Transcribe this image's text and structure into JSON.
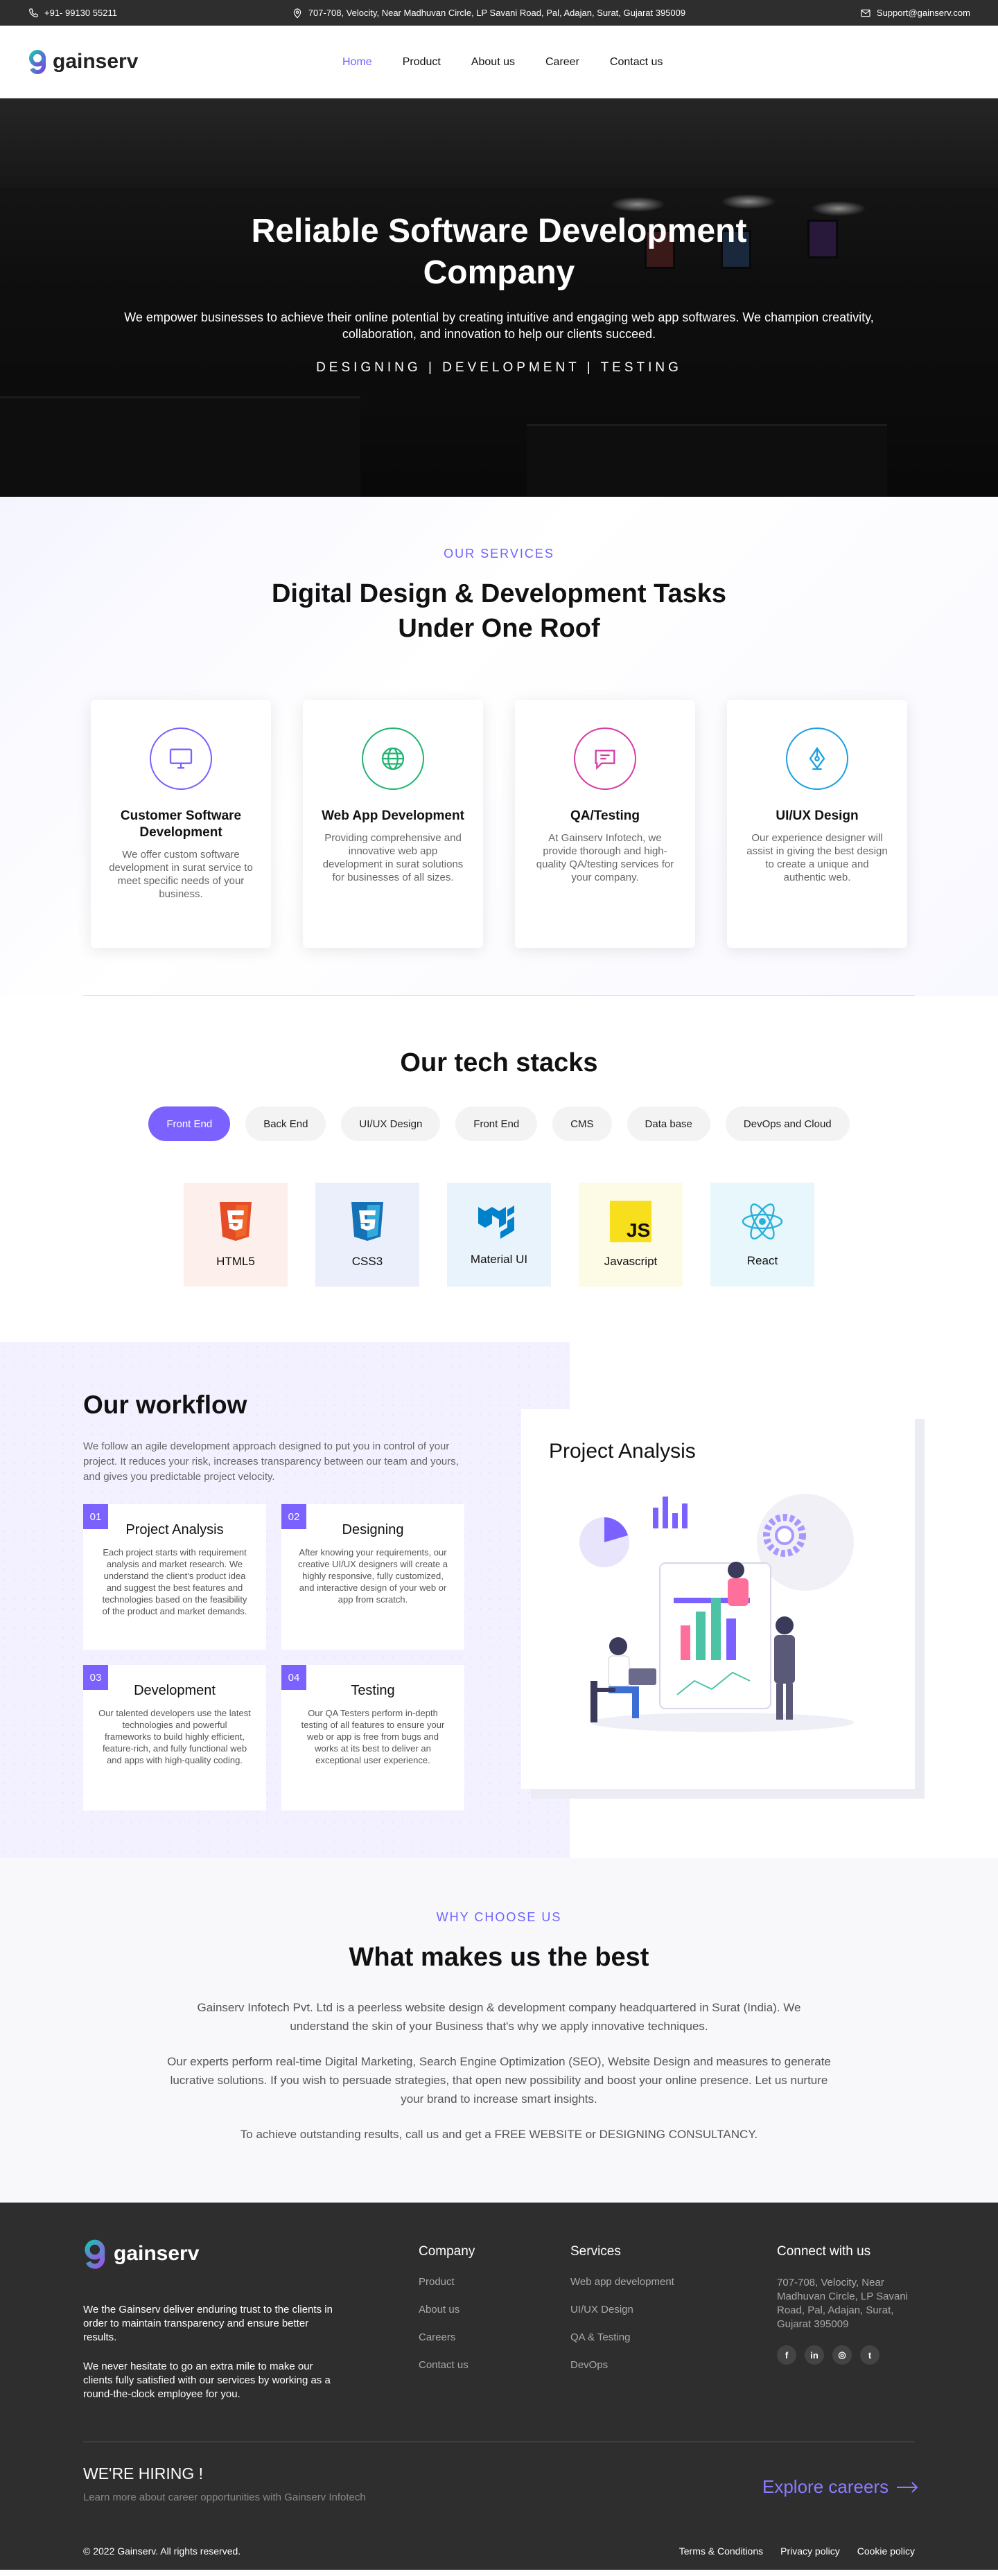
{
  "topbar": {
    "phone": "+91- 99130 55211",
    "address": "707-708, Velocity, Near Madhuvan Circle, LP Savani Road, Pal, Adajan, Surat, Gujarat 395009",
    "email": "Support@gainserv.com"
  },
  "brand": {
    "name": "gainserv",
    "accent": "#6c63ff"
  },
  "nav": [
    "Home",
    "Product",
    "About us",
    "Career",
    "Contact us"
  ],
  "hero": {
    "title": "Reliable Software Development Company",
    "subtitle": "We empower businesses to achieve their online potential by creating intuitive and engaging web app softwares. We champion creativity, collaboration, and innovation to help our clients succeed.",
    "tagline": "DESIGNING | DEVELOPMENT | TESTING"
  },
  "services": {
    "eyebrow": "OUR SERVICES",
    "title": "Digital Design & Development Tasks Under One Roof",
    "cards": [
      {
        "title": "Customer Software Development",
        "text": "We offer custom software development in surat service to meet specific needs of your business.",
        "icon": "monitor-icon",
        "color": "#7b61ff"
      },
      {
        "title": "Web App Development",
        "text": "Providing comprehensive and innovative web app development in surat solutions for businesses of all sizes.",
        "icon": "globe-icon",
        "color": "#21b573"
      },
      {
        "title": "QA/Testing",
        "text": "At Gainserv Infotech, we provide thorough and high-quality QA/testing services for your company.",
        "icon": "chat-icon",
        "color": "#d63ca6"
      },
      {
        "title": "UI/UX Design",
        "text": "Our experience designer will assist in giving the best design to create a unique and authentic web.",
        "icon": "pen-tool-icon",
        "color": "#1ea0e0"
      }
    ]
  },
  "tech": {
    "title": "Our tech stacks",
    "tabs": [
      "Front End",
      "Back End",
      "UI/UX Design",
      "Front End",
      "CMS",
      "Data base",
      "DevOps and Cloud"
    ],
    "items": [
      {
        "label": "HTML5",
        "bg": "#fdf0ec",
        "icon": "html5-icon"
      },
      {
        "label": "CSS3",
        "bg": "#ebeffc",
        "icon": "css3-icon"
      },
      {
        "label": "Material UI",
        "bg": "#e8f3fc",
        "icon": "material-ui-icon"
      },
      {
        "label": "Javascript",
        "bg": "#fdfbe6",
        "icon": "javascript-icon"
      },
      {
        "label": "React",
        "bg": "#e8f7fc",
        "icon": "react-icon"
      }
    ]
  },
  "workflow": {
    "title": "Our workflow",
    "intro": "We follow an agile development approach designed to put you in control of your project. It reduces your risk, increases transparency between our team and yours, and gives you predictable project velocity.",
    "steps": [
      {
        "num": "01",
        "title": "Project Analysis",
        "text": "Each project starts with requirement analysis and market research. We understand the client's product idea and suggest the best features and technologies based on the feasibility of the product and market demands."
      },
      {
        "num": "02",
        "title": "Designing",
        "text": "After knowing your requirements, our creative UI/UX designers will create a highly responsive, fully customized, and interactive design of your web or app from scratch."
      },
      {
        "num": "03",
        "title": "Development",
        "text": "Our talented developers use the latest technologies and powerful frameworks to build highly efficient, feature-rich, and fully functional web and apps with high-quality coding."
      },
      {
        "num": "04",
        "title": "Testing",
        "text": "Our QA Testers perform in-depth testing of all features to ensure your web or app is free from bugs and works at its best to deliver an exceptional user experience."
      }
    ],
    "panel_title": "Project Analysis"
  },
  "why": {
    "eyebrow": "WHY CHOOSE US",
    "title": "What makes us the best",
    "p1": "Gainserv Infotech Pvt. Ltd is a peerless website design & development company headquartered in Surat (India). We understand the skin of your Business that's why we apply innovative techniques.",
    "p2": "Our experts perform real-time Digital Marketing, Search Engine Optimization (SEO), Website Design and measures to generate lucrative solutions. If you wish to persuade strategies, that open new possibility and boost your online presence. Let us nurture your brand to increase smart insights.",
    "p3": "To achieve outstanding results, call us and get a FREE WEBSITE or DESIGNING CONSULTANCY."
  },
  "footer": {
    "about1": "We the Gainserv deliver enduring trust to the clients in order to maintain transparency and ensure better results.",
    "about2": "We never hesitate to go an extra mile to make our clients fully satisfied with our services by working as a round-the-clock employee for you.",
    "company": {
      "title": "Company",
      "links": [
        "Product",
        "About us",
        "Careers",
        "Contact us"
      ]
    },
    "services": {
      "title": "Services",
      "links": [
        "Web app development",
        "UI/UX Design",
        "QA & Testing",
        "DevOps"
      ]
    },
    "connect": {
      "title": "Connect with us",
      "address": "707-708, Velocity, Near Madhuvan Circle, LP Savani Road, Pal, Adajan, Surat, Gujarat 395009",
      "socials": [
        "facebook-icon",
        "linkedin-icon",
        "instagram-icon",
        "twitter-icon"
      ]
    },
    "hiring": {
      "title": "WE'RE HIRING !",
      "text": "Learn more about career opportunities with Gainserv Infotech",
      "cta": "Explore careers"
    },
    "copyright": "© 2022 Gainserv. All rights reserved.",
    "legal": [
      "Terms & Conditions",
      "Privacy policy",
      "Cookie policy"
    ]
  }
}
